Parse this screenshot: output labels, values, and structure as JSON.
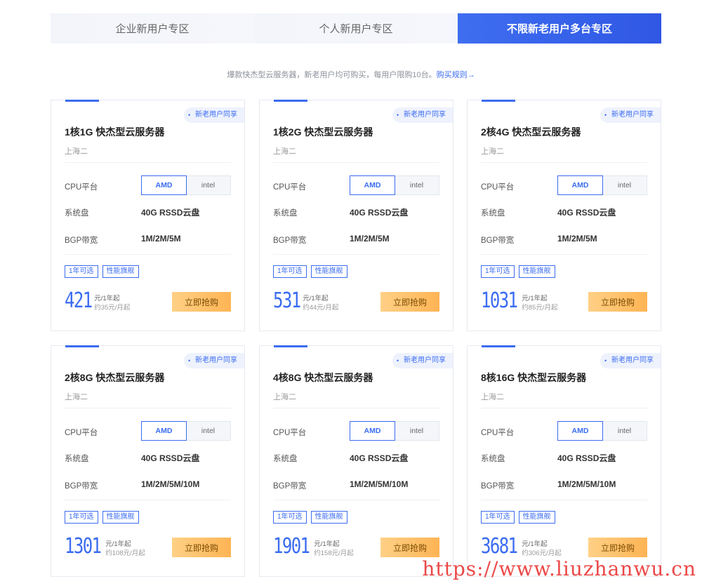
{
  "tabs": [
    {
      "label": "企业新用户专区",
      "active": false
    },
    {
      "label": "个人新用户专区",
      "active": false
    },
    {
      "label": "不限新老用户多台专区",
      "active": true
    }
  ],
  "notice": {
    "text": "爆款快杰型云服务器，新老用户均可购买，每用户限购10台。",
    "link": "购买规则→"
  },
  "labels": {
    "cpu": "CPU平台",
    "disk": "系统盘",
    "bandwidth": "BGP带宽",
    "amd": "AMD",
    "intel": "intel",
    "buy": "立即抢购",
    "badge": "新老用户同享",
    "tag1": "1年可选",
    "tag2": "性能旗舰",
    "unit": "元/1年起"
  },
  "cards": [
    {
      "title": "1核1G 快杰型云服务器",
      "region": "上海二",
      "disk": "40G RSSD云盘",
      "bandwidth": "1M/2M/5M",
      "price": "421",
      "monthly": "约35元/月起"
    },
    {
      "title": "1核2G 快杰型云服务器",
      "region": "上海二",
      "disk": "40G RSSD云盘",
      "bandwidth": "1M/2M/5M",
      "price": "531",
      "monthly": "约44元/月起"
    },
    {
      "title": "2核4G 快杰型云服务器",
      "region": "上海二",
      "disk": "40G RSSD云盘",
      "bandwidth": "1M/2M/5M",
      "price": "1031",
      "monthly": "约85元/月起"
    },
    {
      "title": "2核8G 快杰型云服务器",
      "region": "上海二",
      "disk": "40G RSSD云盘",
      "bandwidth": "1M/2M/5M/10M",
      "price": "1301",
      "monthly": "约108元/月起"
    },
    {
      "title": "4核8G 快杰型云服务器",
      "region": "上海二",
      "disk": "40G RSSD云盘",
      "bandwidth": "1M/2M/5M/10M",
      "price": "1901",
      "monthly": "约158元/月起"
    },
    {
      "title": "8核16G 快杰型云服务器",
      "region": "上海二",
      "disk": "40G RSSD云盘",
      "bandwidth": "1M/2M/5M/10M",
      "price": "3681",
      "monthly": "约306元/月起"
    }
  ],
  "watermark": "https://www.liuzhanwu.cn",
  "colors": {
    "accent": "#3b6cf0",
    "buy": "#ffb454"
  }
}
